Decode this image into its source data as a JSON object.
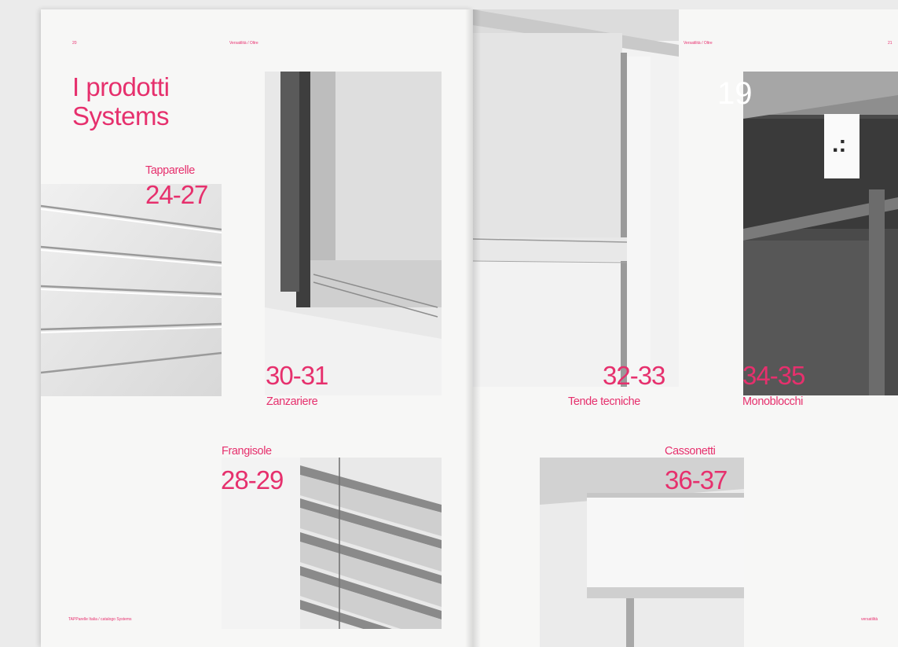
{
  "spread": {
    "left_page": {
      "title_line1": "I prodotti",
      "title_line2": "Systems",
      "header_left": "20",
      "header_center": "Versatilità / Oltre",
      "footer": "TAPParelle Italia / catalogo Systems",
      "sections": [
        {
          "label": "Tapparelle",
          "pages": "24-27"
        },
        {
          "label": "Zanzariere",
          "pages": "30-31"
        },
        {
          "label": "Frangisole",
          "pages": "28-29"
        }
      ]
    },
    "right_page": {
      "header_center": "Versatilità / Oltre",
      "header_right": "21",
      "page_number": "19",
      "footer": "versatilità",
      "sections": [
        {
          "label": "Tende tecniche",
          "pages": "32-33"
        },
        {
          "label": "Monoblocchi",
          "pages": "34-35"
        },
        {
          "label": "Cassonetti",
          "pages": "36-37"
        }
      ]
    }
  },
  "colors": {
    "accent": "#e6306d",
    "paper": "#f7f7f6"
  },
  "icons": [
    "sign-icon"
  ]
}
